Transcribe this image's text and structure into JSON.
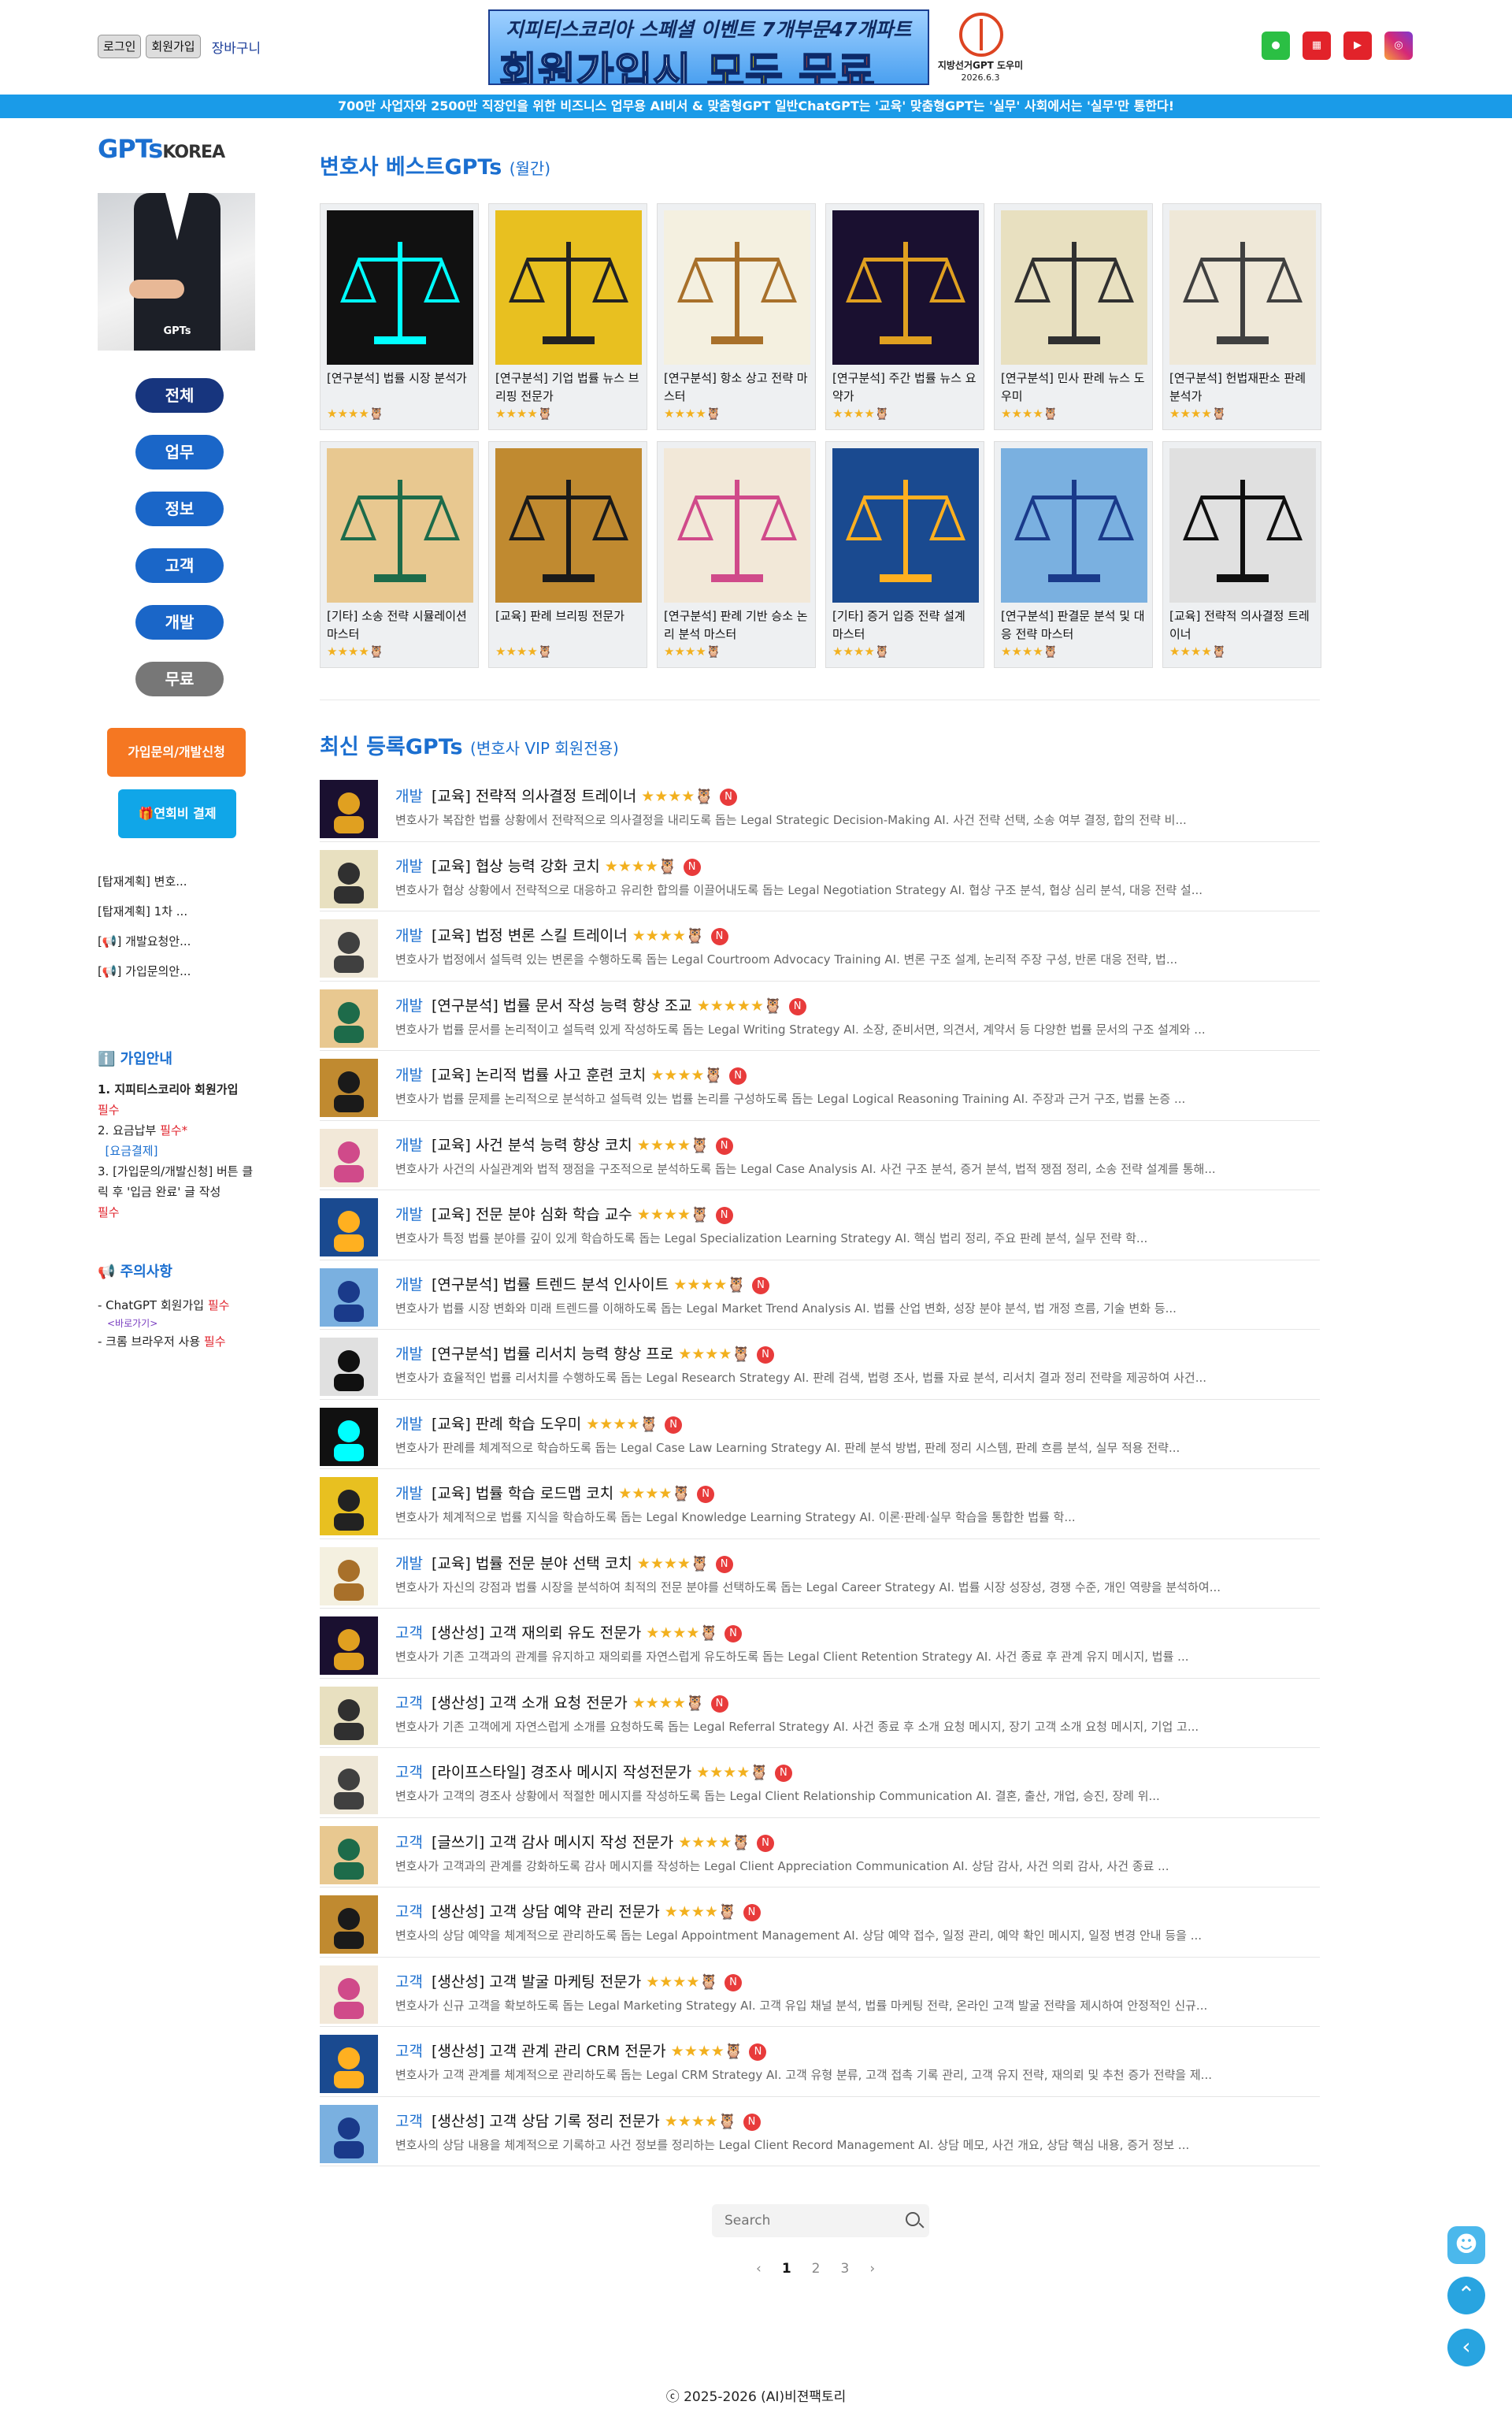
{
  "header": {
    "login": "로그인",
    "signup": "회원가입",
    "cart": "장바구니",
    "banner_line1": "지피티스코리아 스페셜 이벤트   7개부문47개파트",
    "banner_line2a": "회원가입시 ",
    "banner_line2b": "모두 ",
    "banner_line2c": "무료",
    "election_line1": "지방선거GPT 도우미",
    "election_line2": "2026.6.3",
    "sns": [
      "line-icon",
      "shop-icon",
      "youtube-icon",
      "instagram-icon"
    ]
  },
  "strip": "700만 사업자와 2500만 직장인을 위한 비즈니스 업무용 AI비서 & 맞춤형GPT   일반ChatGPT는 '교육' 맞춤형GPT는 '실무'  사회에서는 '실무'만 통한다!",
  "sidebar": {
    "logo_a": "GPTs",
    "logo_b": "KOREA",
    "portrait_tag": "GPTs",
    "categories": [
      "전체",
      "업무",
      "정보",
      "고객",
      "개발",
      "무료"
    ],
    "join_btn": "가입문의/개발신청",
    "fee_btn": "🎁연회비 결제",
    "notices": [
      "[탑재계획] 변호...",
      "[탑재계획] 1차 ...",
      "[📢] 개발요청안...",
      "[📢] 가입문의안..."
    ],
    "guide_title": "ℹ️ 가입안내",
    "guide_1": "1. 지피티스코리아 회원가입",
    "guide_1_req": "필수",
    "guide_2": "2. 요금납부",
    "guide_2_req": "필수*",
    "guide_2_link": "[요금결제]",
    "guide_3": "3. [가입문의/개발신청] 버튼 클릭 후 '입금 완료' 글 작성",
    "guide_3_req": "필수",
    "caution_title": "📢 주의사항",
    "caution_1": "- ChatGPT 회원가입",
    "caution_1_req": "필수",
    "caution_1_link": "<바로가기>",
    "caution_2": "- 크롬 브라우저 사용",
    "caution_2_req": "필수"
  },
  "best": {
    "title": "변호사 베스트GPTs",
    "sub": "(월간)",
    "cards": [
      {
        "title": "[연구분석] 법률 시장 분석가",
        "stars": "★★★★🦉"
      },
      {
        "title": "[연구분석] 기업 법률 뉴스 브리핑 전문가",
        "stars": "★★★★🦉"
      },
      {
        "title": "[연구분석] 항소 상고 전략 마스터",
        "stars": "★★★★🦉"
      },
      {
        "title": "[연구분석] 주간 법률 뉴스 요약가",
        "stars": "★★★★🦉"
      },
      {
        "title": "[연구분석] 민사 판례 뉴스 도우미",
        "stars": "★★★★🦉"
      },
      {
        "title": "[연구분석] 헌법재판소 판례 분석가",
        "stars": "★★★★🦉"
      },
      {
        "title": "[기타] 소송 전략 시뮬레이션 마스터",
        "stars": "★★★★🦉"
      },
      {
        "title": "[교육] 판례 브리핑 전문가",
        "stars": "★★★★🦉"
      },
      {
        "title": "[연구분석] 판례 기반 승소 논리 분석 마스터",
        "stars": "★★★★🦉"
      },
      {
        "title": "[기타] 증거 입증 전략 설계 마스터",
        "stars": "★★★★🦉"
      },
      {
        "title": "[연구분석] 판결문 분석 및 대응 전략 마스터",
        "stars": "★★★★🦉"
      },
      {
        "title": "[교육] 전략적 의사결정 트레이너",
        "stars": "★★★★🦉"
      }
    ]
  },
  "latest": {
    "title": "최신 등록GPTs",
    "sub": "(변호사 VIP 회원전용)",
    "badge": "N",
    "rows": [
      {
        "cat": "개발",
        "title": "[교육] 전략적 의사결정 트레이너",
        "stars": "★★★★🦉",
        "desc": "변호사가 복잡한 법률 상황에서 전략적으로 의사결정을 내리도록 돕는 Legal Strategic Decision-Making AI. 사건 전략 선택, 소송 여부 결정, 합의 전략 비..."
      },
      {
        "cat": "개발",
        "title": "[교육] 협상 능력 강화 코치",
        "stars": "★★★★🦉",
        "desc": "변호사가 협상 상황에서 전략적으로 대응하고 유리한 합의를 이끌어내도록 돕는 Legal Negotiation Strategy AI. 협상 구조 분석, 협상 심리 분석, 대응 전략 설..."
      },
      {
        "cat": "개발",
        "title": "[교육] 법정 변론 스킬 트레이너",
        "stars": "★★★★🦉",
        "desc": "변호사가 법정에서 설득력 있는 변론을 수행하도록 돕는 Legal Courtroom Advocacy Training AI. 변론 구조 설계, 논리적 주장 구성, 반론 대응 전략, 법..."
      },
      {
        "cat": "개발",
        "title": "[연구분석] 법률 문서 작성 능력 향상 조교",
        "stars": "★★★★★🦉",
        "desc": "변호사가 법률 문서를 논리적이고 설득력 있게 작성하도록 돕는 Legal Writing Strategy AI. 소장, 준비서면, 의견서, 계약서 등 다양한 법률 문서의 구조 설계와 ..."
      },
      {
        "cat": "개발",
        "title": "[교육] 논리적 법률 사고 훈련 코치",
        "stars": "★★★★🦉",
        "desc": "변호사가 법률 문제를 논리적으로 분석하고 설득력 있는 법률 논리를 구성하도록 돕는 Legal Logical Reasoning Training AI. 주장과 근거 구조, 법률 논증 ..."
      },
      {
        "cat": "개발",
        "title": "[교육] 사건 분석 능력 향상 코치",
        "stars": "★★★★🦉",
        "desc": "변호사가 사건의 사실관계와 법적 쟁점을 구조적으로 분석하도록 돕는 Legal Case Analysis AI. 사건 구조 분석, 증거 분석, 법적 쟁점 정리, 소송 전략 설계를 통해..."
      },
      {
        "cat": "개발",
        "title": "[교육] 전문 분야 심화 학습 교수",
        "stars": "★★★★🦉",
        "desc": "변호사가 특정 법률 분야를 깊이 있게 학습하도록 돕는 Legal Specialization Learning Strategy AI. 핵심 법리 정리, 주요 판례 분석, 실무 전략 학..."
      },
      {
        "cat": "개발",
        "title": "[연구분석] 법률 트렌드 분석 인사이트",
        "stars": "★★★★🦉",
        "desc": "변호사가 법률 시장 변화와 미래 트렌드를 이해하도록 돕는 Legal Market Trend Analysis AI. 법률 산업 변화, 성장 분야 분석, 법 개정 흐름, 기술 변화 등..."
      },
      {
        "cat": "개발",
        "title": "[연구분석] 법률 리서치 능력 향상 프로",
        "stars": "★★★★🦉",
        "desc": "변호사가 효율적인 법률 리서치를 수행하도록 돕는 Legal Research Strategy AI. 판례 검색, 법령 조사, 법률 자료 분석, 리서치 결과 정리 전략을 제공하여 사건..."
      },
      {
        "cat": "개발",
        "title": "[교육] 판례 학습 도우미",
        "stars": "★★★★🦉",
        "desc": "변호사가 판례를 체계적으로 학습하도록 돕는 Legal Case Law Learning Strategy AI. 판례 분석 방법, 판례 정리 시스템, 판례 흐름 분석, 실무 적용 전략..."
      },
      {
        "cat": "개발",
        "title": "[교육] 법률 학습 로드맵 코치",
        "stars": "★★★★🦉",
        "desc": "변호사가 체계적으로 법률 지식을 학습하도록 돕는 Legal Knowledge Learning Strategy AI. 이론·판례·실무 학습을 통합한 법률 학..."
      },
      {
        "cat": "개발",
        "title": "[교육] 법률 전문 분야 선택 코치",
        "stars": "★★★★🦉",
        "desc": "변호사가 자신의 강점과 법률 시장을 분석하여 최적의 전문 분야를 선택하도록 돕는 Legal Career Strategy AI. 법률 시장 성장성, 경쟁 수준, 개인 역량을 분석하여..."
      },
      {
        "cat": "고객",
        "title": "[생산성] 고객 재의뢰 유도 전문가",
        "stars": "★★★★🦉",
        "desc": "변호사가 기존 고객과의 관계를 유지하고 재의뢰를 자연스럽게 유도하도록 돕는 Legal Client Retention Strategy AI. 사건 종료 후 관계 유지 메시지, 법률 ..."
      },
      {
        "cat": "고객",
        "title": "[생산성] 고객 소개 요청 전문가",
        "stars": "★★★★🦉",
        "desc": "변호사가 기존 고객에게 자연스럽게 소개를 요청하도록 돕는 Legal Referral Strategy AI. 사건 종료 후 소개 요청 메시지, 장기 고객 소개 요청 메시지, 기업 고..."
      },
      {
        "cat": "고객",
        "title": "[라이프스타일] 경조사 메시지 작성전문가",
        "stars": "★★★★🦉",
        "desc": "변호사가 고객의 경조사 상황에서 적절한 메시지를 작성하도록 돕는 Legal Client Relationship Communication AI. 결혼, 출산, 개업, 승진, 장례 위..."
      },
      {
        "cat": "고객",
        "title": "[글쓰기] 고객 감사 메시지 작성 전문가",
        "stars": "★★★★🦉",
        "desc": "변호사가 고객과의 관계를 강화하도록 감사 메시지를 작성하는 Legal Client Appreciation Communication AI. 상담 감사, 사건 의뢰 감사, 사건 종료 ..."
      },
      {
        "cat": "고객",
        "title": "[생산성] 고객 상담 예약 관리 전문가",
        "stars": "★★★★🦉",
        "desc": "변호사의 상담 예약을 체계적으로 관리하도록 돕는 Legal Appointment Management AI. 상담 예약 접수, 일정 관리, 예약 확인 메시지, 일정 변경 안내 등을 ..."
      },
      {
        "cat": "고객",
        "title": "[생산성] 고객 발굴 마케팅 전문가",
        "stars": "★★★★🦉",
        "desc": "변호사가 신규 고객을 확보하도록 돕는 Legal Marketing Strategy AI. 고객 유입 채널 분석, 법률 마케팅 전략, 온라인 고객 발굴 전략을 제시하여 안정적인 신규..."
      },
      {
        "cat": "고객",
        "title": "[생산성] 고객 관계 관리 CRM 전문가",
        "stars": "★★★★🦉",
        "desc": "변호사가 고객 관계를 체계적으로 관리하도록 돕는 Legal CRM Strategy AI. 고객 유형 분류, 고객 접촉 기록 관리, 고객 유지 전략, 재의뢰 및 추천 증가 전략을 제..."
      },
      {
        "cat": "고객",
        "title": "[생산성] 고객 상담 기록 정리 전문가",
        "stars": "★★★★🦉",
        "desc": "변호사의 상담 내용을 체계적으로 기록하고 사건 정보를 정리하는 Legal Client Record Management AI. 상담 메모, 사건 개요, 상담 핵심 내용, 증거 정보 ..."
      }
    ]
  },
  "search": {
    "placeholder": "Search"
  },
  "pager": {
    "prev": "‹",
    "pages": [
      "1",
      "2",
      "3"
    ],
    "next": "›"
  },
  "footer": "ⓒ 2025-2026 (AI)비젼팩토리"
}
